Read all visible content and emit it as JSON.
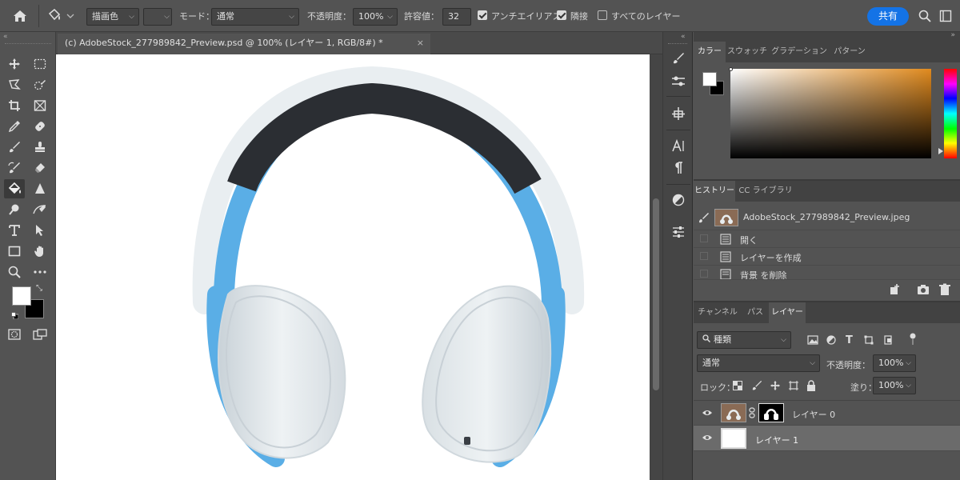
{
  "options_bar": {
    "fill_source": "描画色",
    "mode_label": "モード：",
    "mode_value": "通常",
    "opacity_label": "不透明度：",
    "opacity_value": "100%",
    "tolerance_label": "許容値：",
    "tolerance_value": "32",
    "antialias_label": "アンチエイリアス",
    "antialias_checked": true,
    "contiguous_label": "隣接",
    "contiguous_checked": true,
    "all_layers_label": "すべてのレイヤー",
    "all_layers_checked": false,
    "share_label": "共有"
  },
  "document": {
    "tab_title": "(c) AdobeStock_277989842_Preview.psd @ 100% (レイヤー 1, RGB/8#) *",
    "close_glyph": "×"
  },
  "color_panel": {
    "tabs": [
      "カラー",
      "スウォッチ",
      "グラデーション",
      "パターン"
    ],
    "active_tab": 0,
    "hue_color": "#e08a1e"
  },
  "history_panel": {
    "tabs": [
      "ヒストリー",
      "CC ライブラリ"
    ],
    "active_tab": 0,
    "snapshot_name": "AdobeStock_277989842_Preview.jpeg",
    "steps": [
      "開く",
      "レイヤーを作成",
      "背景 を削除"
    ]
  },
  "layers_panel": {
    "tabs": [
      "チャンネル",
      "パス",
      "レイヤー"
    ],
    "active_tab": 2,
    "filter_label": "種類",
    "blend_mode": "通常",
    "opacity_label": "不透明度：",
    "opacity_value": "100%",
    "lock_label": "ロック：",
    "fill_label": "塗り：",
    "fill_value": "100%",
    "layers": [
      {
        "name": "レイヤー 0",
        "selected": false
      },
      {
        "name": "レイヤー 1",
        "selected": true
      }
    ]
  },
  "colors": {
    "accent": "#1473e6",
    "foreground": "#ffffff",
    "background": "#000000",
    "headphone_band": "#2b2e33",
    "headphone_blue": "#5aaee6",
    "headphone_white": "#e8edf0"
  }
}
